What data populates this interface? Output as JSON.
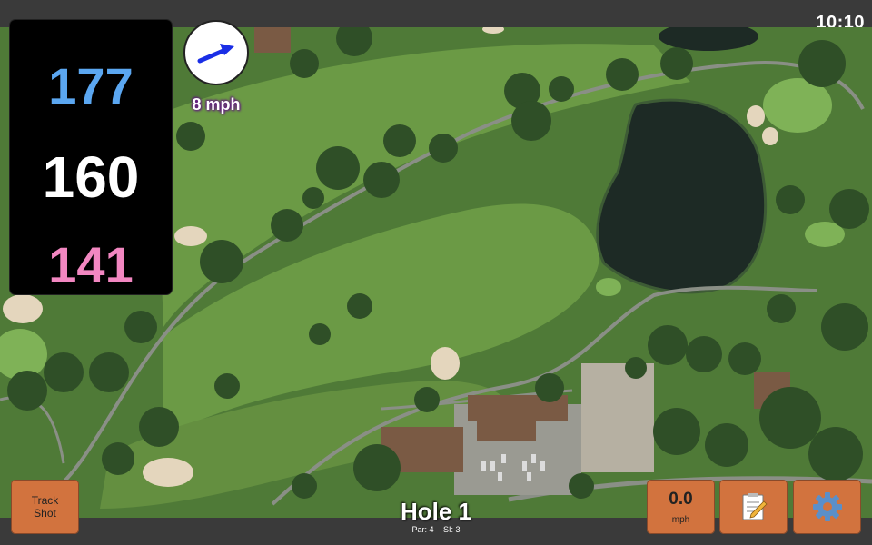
{
  "status_bar": {
    "time": "10:10"
  },
  "distances": {
    "back": "177",
    "middle": "160",
    "front": "141"
  },
  "wind": {
    "speed": "8 mph",
    "arrow_icon": "wind-arrow-icon"
  },
  "hole": {
    "title": "Hole 1",
    "par": "Par: 4",
    "stroke_index": "SI: 3"
  },
  "buttons": {
    "track_shot_line1": "Track",
    "track_shot_line2": "Shot",
    "speed_value": "0.0",
    "speed_unit": "mph",
    "notes_icon": "notepad-icon",
    "settings_icon": "gear-icon"
  },
  "colors": {
    "back_distance": "#5ba7f1",
    "middle_distance": "#ffffff",
    "front_distance": "#f287c1",
    "button_bg": "#d2733e",
    "wind_arrow": "#1a2ee6"
  }
}
